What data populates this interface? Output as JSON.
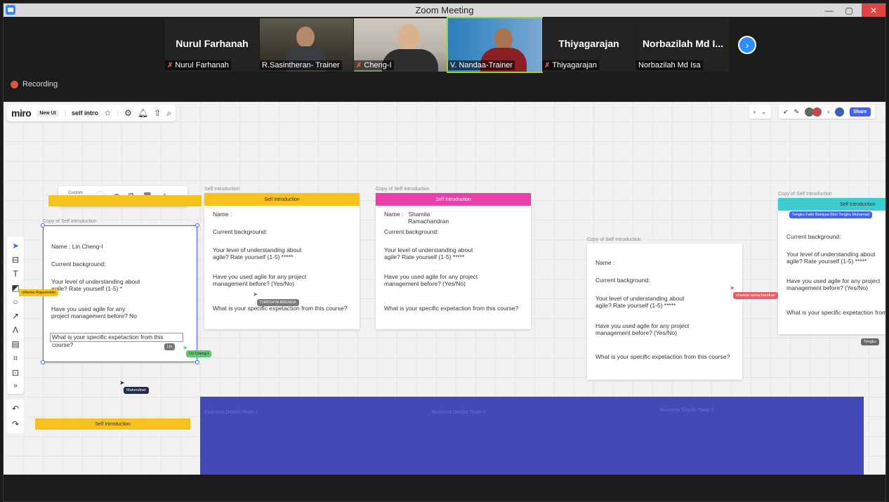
{
  "window": {
    "title": "Zoom Meeting",
    "minimize": "—",
    "maximize": "▢",
    "close": "✕"
  },
  "participants": [
    {
      "big_name": "Nurul Farhanah",
      "label": "Nurul Farhanah",
      "muted": true,
      "video": false
    },
    {
      "big_name": "",
      "label": "R.Sasintheran- Trainer",
      "muted": false,
      "video": true
    },
    {
      "big_name": "",
      "label": "Cheng-I",
      "muted": true,
      "video": true
    },
    {
      "big_name": "",
      "label": "V. Nandaa-Trainer",
      "muted": false,
      "video": true,
      "active_speaker": true
    },
    {
      "big_name": "Thiyagarajan",
      "label": "Thiyagarajan",
      "muted": true,
      "video": false
    },
    {
      "big_name": "Norbazilah Md I...",
      "label": "Norbazilah Md Isa",
      "muted": false,
      "video": false
    }
  ],
  "recording_label": "Recording",
  "miro": {
    "logo": "miro",
    "new_ui": "New UI",
    "board_name": "self intro",
    "share_label": "Share",
    "context_toolbar": {
      "custom_ratio": "Custom ratio"
    }
  },
  "cards": [
    {
      "frame": "Copy of Self Introduction",
      "name": "Name : Lin Cheng-I",
      "background": "Current background:",
      "understanding": "Your level of understanding about agile? Rate yourself (1-5) *",
      "agile_used": "Have you used agile for any project management before? No",
      "expectation": "What is your specific expetaction from this course?"
    },
    {
      "frame": "Self Introduction",
      "header": "Self Introduction",
      "name": "Name :",
      "background": "Current background:",
      "understanding": "Your level of understanding about agile? Rate yourself (1-5) *****",
      "agile_used": "Have you used agile for any project management before? (Yes/No)",
      "expectation": "What is your specific expetaction from this course?"
    },
    {
      "frame": "Copy of Self Introduction",
      "header": "Self Introduction",
      "name": "Name :   Shamila",
      "name2": "Ramachandran",
      "background": "Current background:",
      "understanding": "Your level of understanding about agile? Rate yourself (1-5) *****",
      "agile_used": "Have you used agile for any project management before? (Yes/No)",
      "expectation": "What is your specific expetaction from this course?"
    },
    {
      "frame": "Copy of Self Introduction",
      "name": "Name :",
      "background": "Current background:",
      "understanding": "Your level of understanding about agile? Rate yourself (1-5) *****",
      "agile_used": "Have you used agile for any project management before? (Yes/No)",
      "expectation": "What is your specific expetaction from this course?"
    },
    {
      "frame": "Copy of Self Introduction",
      "header": "Self Introduction",
      "background": "Current background:",
      "understanding": "Your level of understanding about agile? Rate yourself (1-5) *****",
      "agile_used": "Have you used agile for any project management before? (Yes/No)",
      "expectation": "What is your specific expetaction from this course?"
    }
  ],
  "yellow_label": "Self Introduction",
  "business_frames": [
    "Business Details Team 1",
    "Business Details Team 2",
    "Business Details Team 3"
  ],
  "cursors": [
    {
      "name": "THRISHYA BRENDA",
      "color": "#7a7a7a"
    },
    {
      "name": "Lin Cheng-I",
      "color": "#5fc96f"
    },
    {
      "name": "Mahendran",
      "color": "#1f2d4a"
    },
    {
      "name": "shamila ramachandran",
      "color": "#e6606a"
    },
    {
      "name": "Tengku Fatin Bahiyya Binti Tengku Muhamad",
      "color": "#4262ff"
    },
    {
      "name": "Tengku",
      "color": "#6a6a6a"
    },
    {
      "name": "ntheran Rajaverdan",
      "color": "#f7c21b"
    },
    {
      "name": "Lin",
      "color": "#777777"
    }
  ],
  "colors": {
    "yellow": "#f7c21b",
    "pink": "#ea3fa8",
    "teal": "#3dccd0",
    "purple": "#4449b8",
    "zoom_blue": "#2d8cff"
  }
}
